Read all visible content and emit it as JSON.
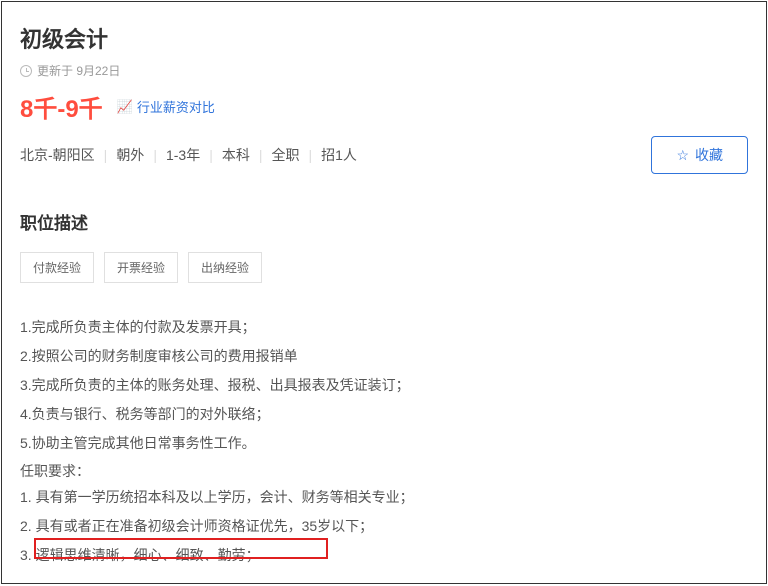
{
  "job": {
    "title": "初级会计",
    "updateLabel": "更新于 9月22日",
    "salary": "8千-9千",
    "compareLink": "行业薪资对比",
    "location": "北京-朝阳区",
    "area": "朝外",
    "experience": "1-3年",
    "education": "本科",
    "jobType": "全职",
    "headcount": "招1人",
    "collectLabel": "收藏"
  },
  "section": {
    "descTitle": "职位描述"
  },
  "skills": [
    "付款经验",
    "开票经验",
    "出纳经验"
  ],
  "duties": [
    "1.完成所负责主体的付款及发票开具；",
    "2.按照公司的财务制度审核公司的费用报销单",
    "3.完成所负责的主体的账务处理、报税、出具报表及凭证装订；",
    "4.负责与银行、税务等部门的对外联络；",
    "5.协助主管完成其他日常事务性工作。"
  ],
  "reqTitle": "任职要求：",
  "requirements": [
    {
      "prefix": "1. ",
      "text": "具有第一学历统招本科及以上学历，会计、财务等相关专业；"
    },
    {
      "prefix": "2. ",
      "highlight": "具有或者正在准备初级会计师资格证优先，",
      "rest": "35岁以下；"
    },
    {
      "prefix": "3. ",
      "text": "逻辑思维清晰，细心、细致、勤劳；"
    }
  ]
}
